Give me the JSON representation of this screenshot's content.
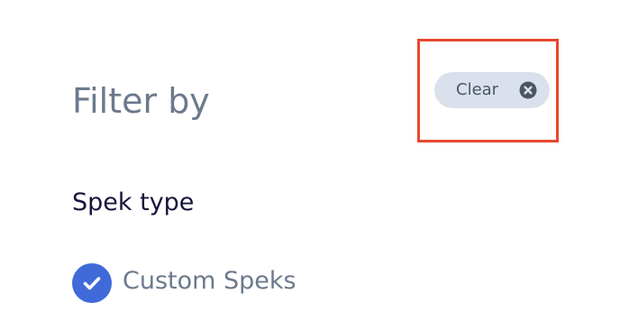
{
  "filter": {
    "title": "Filter by",
    "clear_label": "Clear",
    "clear_icon": "close-circle-icon",
    "highlight_color": "#e8482f"
  },
  "sections": [
    {
      "heading": "Spek type",
      "options": [
        {
          "label": "Custom Speks",
          "checked": true,
          "icon": "check-icon",
          "color": "#3f6ad8"
        }
      ]
    }
  ]
}
